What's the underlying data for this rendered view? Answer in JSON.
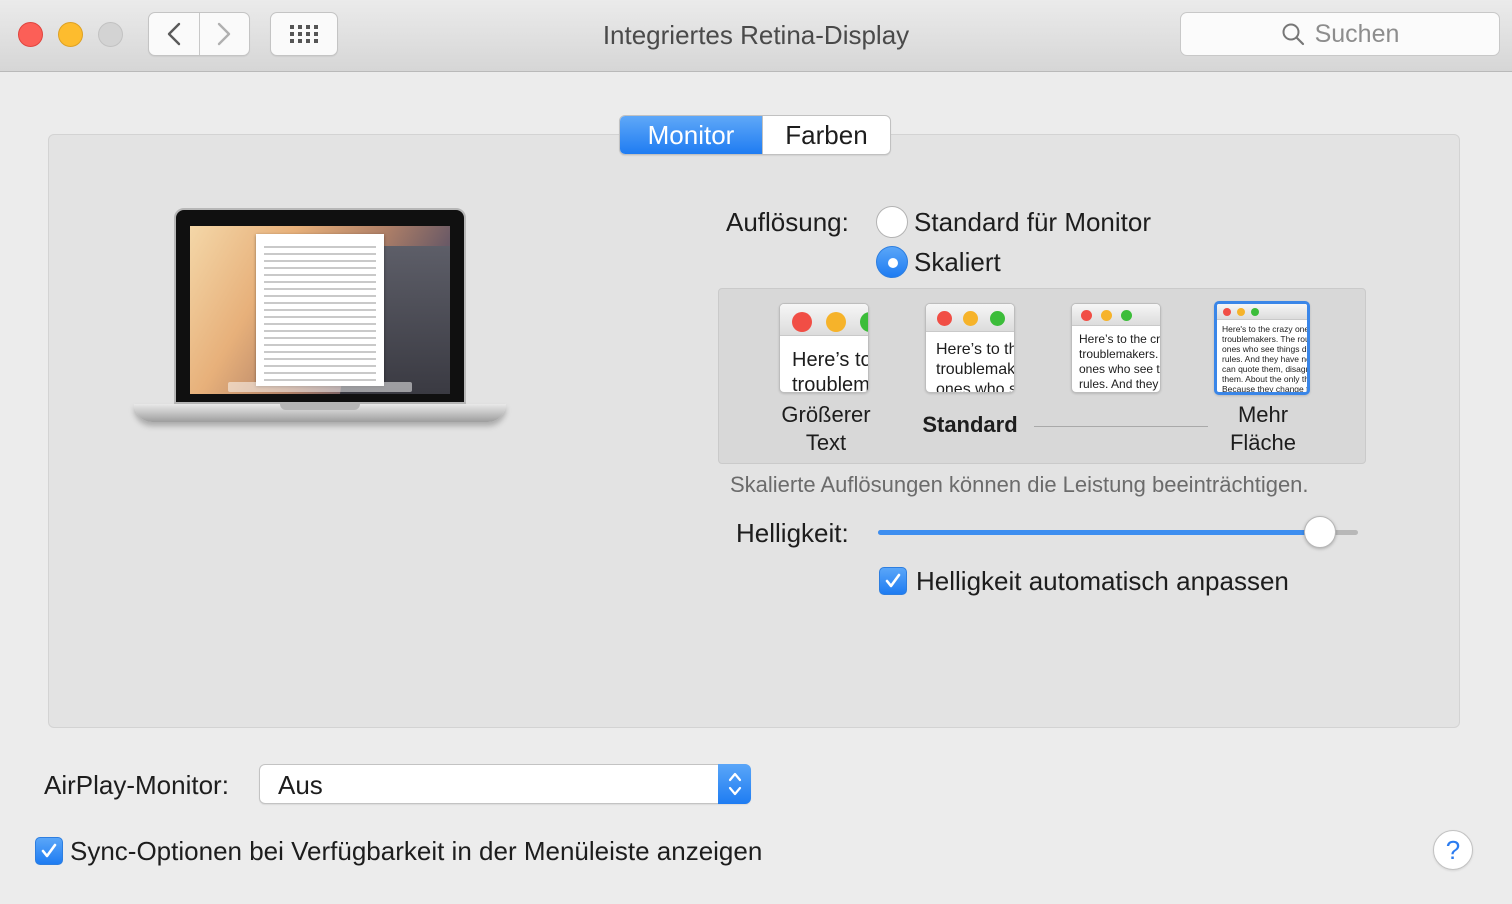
{
  "window": {
    "title": "Integriertes Retina-Display",
    "search_placeholder": "Suchen"
  },
  "tabs": [
    {
      "label": "Monitor",
      "active": true
    },
    {
      "label": "Farben",
      "active": false
    }
  ],
  "resolution": {
    "label": "Auflösung:",
    "options": [
      {
        "label": "Standard für Monitor",
        "selected": false
      },
      {
        "label": "Skaliert",
        "selected": true
      }
    ],
    "scaled": {
      "thumbs": [
        {
          "text": "Here’s to",
          "text2": "troublem"
        },
        {
          "text": "Here’s to th",
          "text2": "troublemak",
          "text3": "ones who s"
        },
        {
          "text": "Here’s to the cr",
          "text2": "troublemakers.",
          "text3": "ones who see t",
          "text4": "rules. And they"
        },
        {
          "text": "Here's to the crazy one",
          "text2": "troublemakers. The rou",
          "text3": "ones who see things dif",
          "text4": "rules. And they have no",
          "text5": "can quote them, disagr",
          "text6": "them. About the only th",
          "text7": "Because they change t"
        }
      ],
      "labels": {
        "larger_line1": "Größerer",
        "larger_line2": "Text",
        "default": "Standard",
        "more_line1": "Mehr",
        "more_line2": "Fläche"
      },
      "selected_index": 3
    },
    "hint": "Skalierte Auflösungen können die Leistung beeinträchtigen."
  },
  "brightness": {
    "label": "Helligkeit:",
    "value_percent": 92,
    "auto_label": "Helligkeit automatisch anpassen",
    "auto_checked": true
  },
  "airplay": {
    "label": "AirPlay-Monitor:",
    "value": "Aus"
  },
  "sync": {
    "label": "Sync-Optionen bei Verfügbarkeit in der Menüleiste anzeigen",
    "checked": true
  },
  "help_label": "?",
  "colors": {
    "accent": "#1f7cf2",
    "close": "#fc5f57",
    "minimize": "#fdbc2e",
    "zoom_disabled": "#d3d3d3"
  },
  "icons": {
    "back": "chevron-left-icon",
    "forward": "chevron-right-icon",
    "grid": "grid-icon",
    "search": "search-icon",
    "popup": "up-down-chevron-icon",
    "check": "checkmark-icon"
  }
}
